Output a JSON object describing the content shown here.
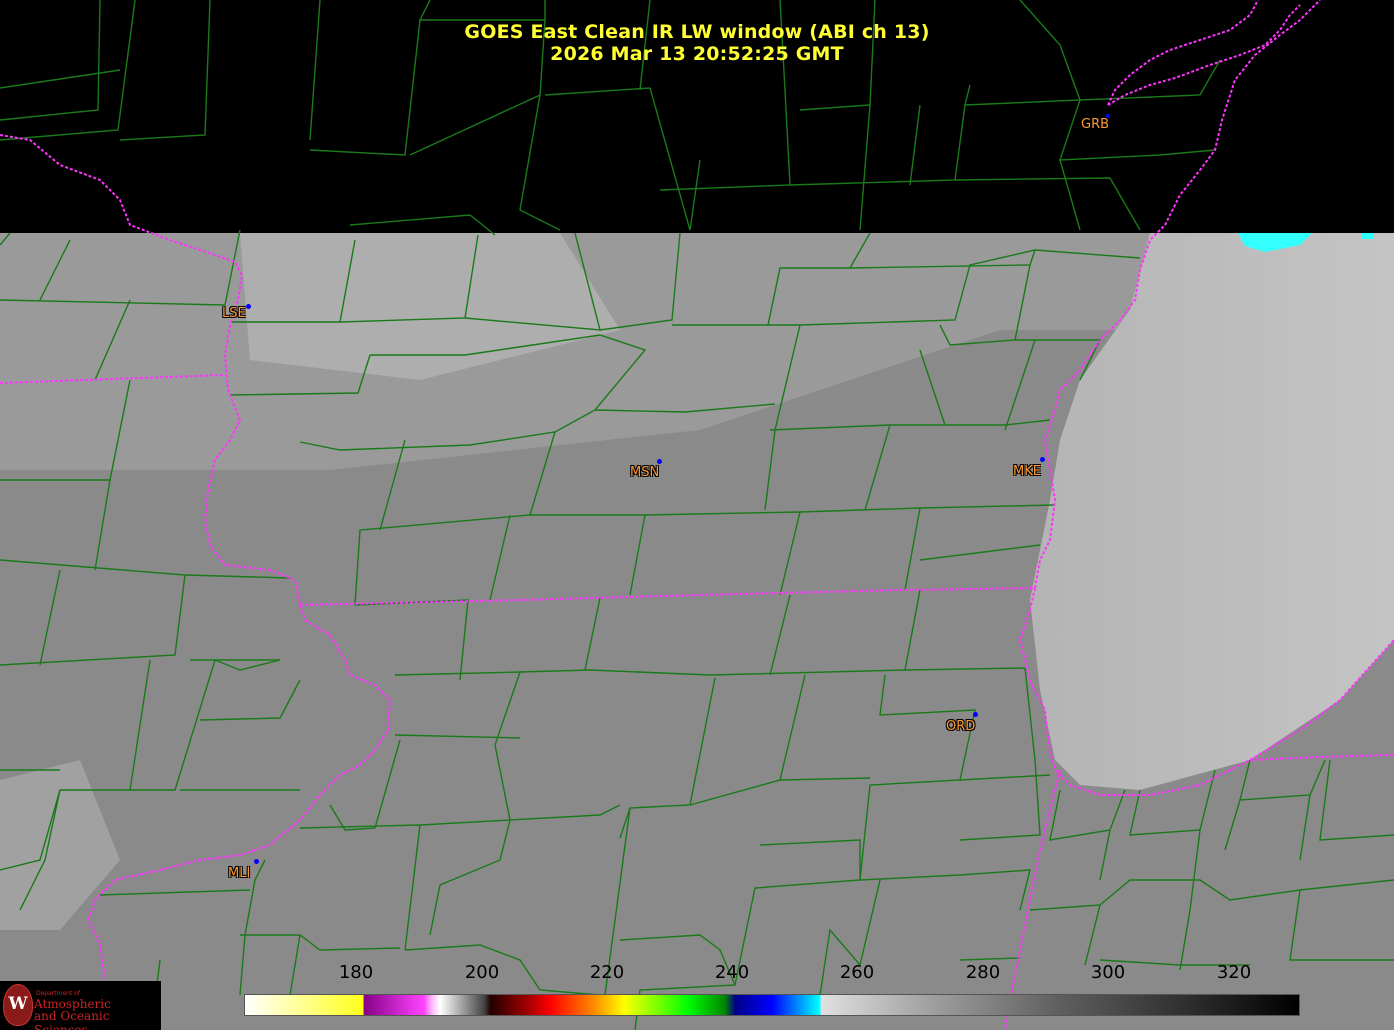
{
  "title": {
    "line1": "GOES East Clean IR LW window (ABI ch 13)",
    "line2": "2026 Mar 13  20:52:25 GMT"
  },
  "stations": [
    {
      "id": "GRB"
    },
    {
      "id": "LSE"
    },
    {
      "id": "MSN"
    },
    {
      "id": "MKE"
    },
    {
      "id": "ORD"
    },
    {
      "id": "MLI"
    }
  ],
  "colorbar": {
    "ticks": [
      "180",
      "200",
      "220",
      "240",
      "260",
      "280",
      "300",
      "320"
    ]
  },
  "logo": {
    "letter": "W",
    "line1": "Department of",
    "line2": "Atmospheric",
    "line3": "and Oceanic Sciences"
  },
  "colors": {
    "title": "#ffff33",
    "station_label": "#ff9933",
    "station_dot": "#0000ff",
    "county_lines": "#1a7a1a",
    "state_lines": "#ff33ff"
  }
}
